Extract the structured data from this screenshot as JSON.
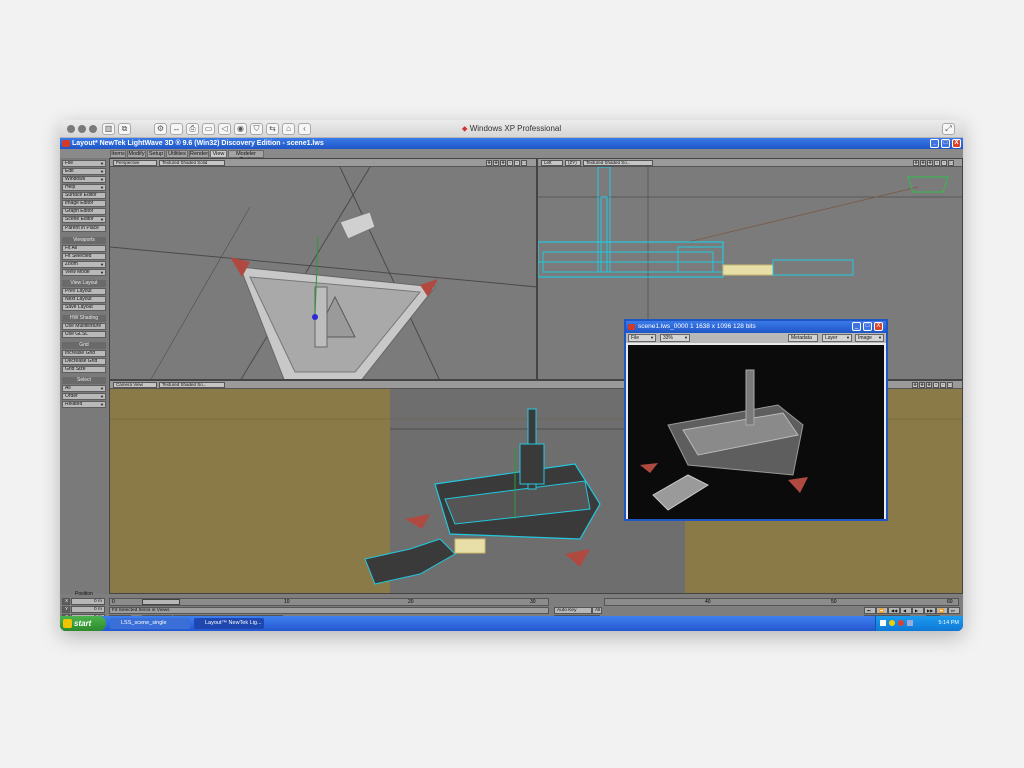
{
  "host": {
    "title": "Windows XP Professional",
    "toolbar_icons": [
      "wrench-icon",
      "arrows-icon",
      "print-icon",
      "disk-icon",
      "speaker-icon",
      "camera-icon",
      "shield-icon",
      "share-icon",
      "tag-icon",
      "back-icon"
    ]
  },
  "window": {
    "title": "Layout* NewTek LightWave 3D ® 9.6 (Win32) Discovery Edition - scene1.lws",
    "controls": [
      "_",
      "□",
      "X"
    ]
  },
  "tabs": [
    {
      "label": "Items"
    },
    {
      "label": "Modify"
    },
    {
      "label": "Setup"
    },
    {
      "label": "Utilities"
    },
    {
      "label": "Render"
    },
    {
      "label": "View",
      "active": true
    },
    {
      "label": "Modeler Tools"
    }
  ],
  "sidebar": {
    "menu": [
      "File",
      "Edit",
      "Windows",
      "Help",
      "Surface Editor",
      "Image Editor",
      "Graph Editor",
      "Scene Editor",
      "Parent in Place"
    ],
    "viewports_header": "Viewports",
    "viewports": [
      "Fit All",
      "Fit Selected",
      "Zoom",
      "View Mode"
    ],
    "view_layout_header": "View Layout",
    "view_layout": [
      "Prev Layout",
      "Next Layout",
      "Save Layout"
    ],
    "shading_header": "HW Shading",
    "shading": [
      "Use Multitexture",
      "Use GLSL"
    ],
    "grid_header": "Grid",
    "grid": [
      "Increase Grid",
      "Decrease Grid",
      "Grid Size"
    ],
    "select_header": "Select",
    "select": [
      "All",
      "Order",
      "Related"
    ]
  },
  "viewports": {
    "tl": {
      "view": "Perspective",
      "shade": "Textured Shaded Solid"
    },
    "tr": {
      "view": "Left",
      "axis": "(ZY)",
      "shade": "Textured Shaded So..."
    },
    "bl": {
      "view": "Camera View",
      "shade": "Textured Shaded So..."
    }
  },
  "render_window": {
    "title": "scene1.lws_0000 1  1638 x 1096 128 bits",
    "menu": [
      "File",
      "33%",
      "Metadata",
      "Layer",
      "Image"
    ]
  },
  "bottom": {
    "position_label": "Position",
    "x": {
      "label": "X",
      "value": "0 m"
    },
    "y": {
      "label": "Y",
      "value": "0 m"
    },
    "z": {
      "label": "Z",
      "value": "0 m"
    },
    "grid": {
      "label": "Grid",
      "value": "100 m"
    },
    "status": "Fit Selected Items in Views",
    "sel_label": "Sel",
    "current_item_label": "Current Item",
    "current_item": "LSS_hire2Layer2",
    "item_tabs": [
      "Objects",
      "Bones",
      "Lights",
      "Cameras",
      "Properties"
    ],
    "timeline_ticks": [
      "0",
      "10",
      "20",
      "30",
      "40",
      "50",
      "60"
    ],
    "timeline_end": "60",
    "frame_field": "0",
    "auto_key": "Auto Key",
    "auto_key_value": "All",
    "create_key": "Create Key",
    "delete_key": "Delete Key",
    "preview": "Preview",
    "step_label": "Step",
    "step_value": "1",
    "transport": [
      "⏮",
      "⏪",
      "◀◀",
      "◀",
      "▶",
      "▶▶",
      "⏩",
      "⏭"
    ]
  },
  "taskbar": {
    "start": "start",
    "tasks": [
      "LSS_scene_single",
      "Layout™ NewTek Lig..."
    ],
    "clock": "5:14 PM"
  }
}
